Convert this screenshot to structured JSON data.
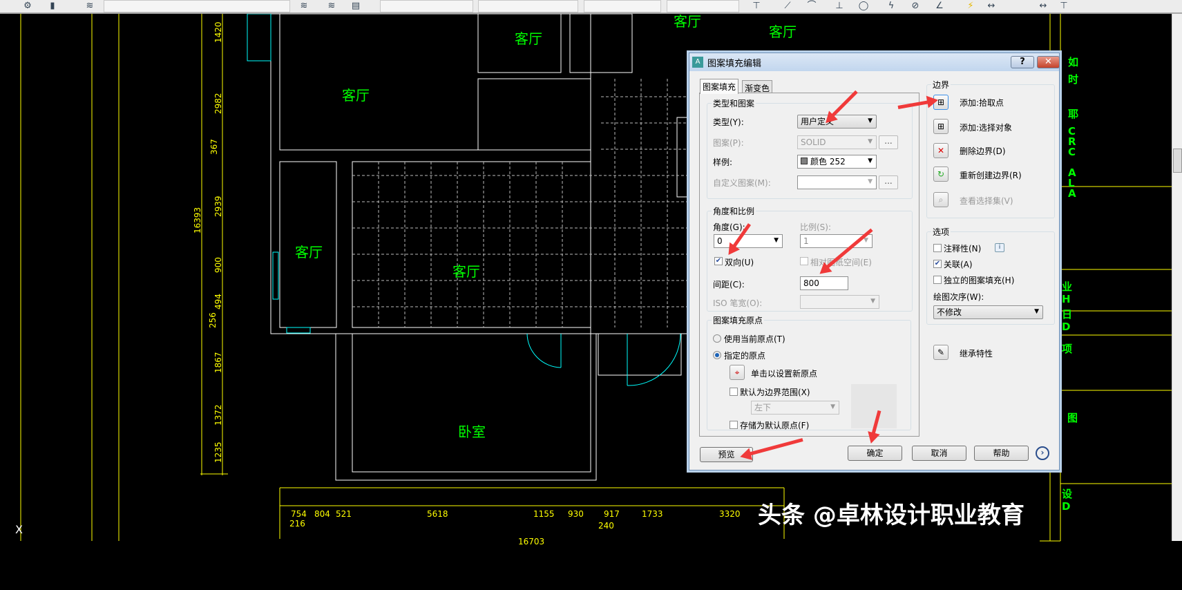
{
  "drawing": {
    "rooms": [
      "客厅",
      "客厅",
      "客厅",
      "客厅",
      "客厅",
      "客厅",
      "卧室"
    ],
    "dims_vertical": [
      "1420",
      "2982",
      "367",
      "2939",
      "900",
      "494",
      "256",
      "1867",
      "1372",
      "1235"
    ],
    "dim_total_vertical": "16393",
    "dims_horizontal": [
      "754",
      "216",
      "804",
      "521",
      "5618",
      "1155",
      "930",
      "917",
      "240",
      "1733",
      "3320"
    ],
    "dim_total_horizontal": "16703",
    "right_panel_text": [
      "如",
      "时",
      "耶",
      "C",
      "R",
      "C",
      "A",
      "L",
      "A",
      "业",
      "H",
      "日",
      "D",
      "项",
      "图",
      "设",
      "D"
    ],
    "colors": {
      "wall": "#ffffff",
      "text": "#00ff00",
      "dimension": "#ffff00",
      "door": "#00ffff"
    }
  },
  "dialog": {
    "title": "图案填充编辑",
    "help_btn": "?",
    "close_btn": "✕",
    "tabs": [
      "图案填充",
      "渐变色"
    ],
    "type_group": {
      "legend": "类型和图案",
      "type_label": "类型(Y):",
      "type_value": "用户定义",
      "pattern_label": "图案(P):",
      "pattern_value": "SOLID",
      "swatch_label": "样例:",
      "swatch_value": "颜色 252",
      "custom_label": "自定义图案(M):",
      "custom_value": "",
      "dots": "..."
    },
    "angle_group": {
      "legend": "角度和比例",
      "angle_label": "角度(G):",
      "angle_value": "0",
      "scale_label": "比例(S):",
      "scale_value": "1",
      "double_label": "双向(U)",
      "double_checked": true,
      "relative_label": "相对图纸空间(E)",
      "relative_checked": false,
      "spacing_label": "间距(C):",
      "spacing_value": "800",
      "iso_label": "ISO 笔宽(O):",
      "iso_value": ""
    },
    "origin_group": {
      "legend": "图案填充原点",
      "use_current": "使用当前原点(T)",
      "specified": "指定的原点",
      "selected": "specified",
      "click_set": "单击以设置新原点",
      "default_extent": "默认为边界范围(X)",
      "extent_value": "左下",
      "store_default": "存储为默认原点(F)"
    },
    "boundary_group": {
      "legend": "边界",
      "items": [
        "添加:拾取点",
        "添加:选择对象",
        "删除边界(D)",
        "重新创建边界(R)",
        "查看选择集(V)"
      ]
    },
    "options_group": {
      "legend": "选项",
      "annotative": "注释性(N)",
      "annotative_checked": false,
      "associative": "关联(A)",
      "associative_checked": true,
      "independent": "独立的图案填充(H)",
      "independent_checked": false,
      "draw_order_label": "绘图次序(W):",
      "draw_order_value": "不修改",
      "info": "i"
    },
    "inherit": "继承特性",
    "buttons": {
      "preview": "预览",
      "ok": "确定",
      "cancel": "取消",
      "help": "帮助",
      "more": "›"
    }
  },
  "watermark": "头条 @卓林设计职业教育"
}
